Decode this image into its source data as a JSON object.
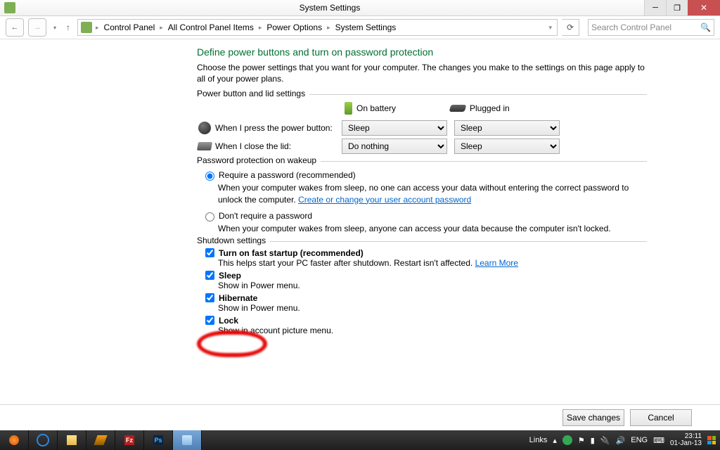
{
  "window": {
    "title": "System Settings"
  },
  "breadcrumb": {
    "items": [
      "Control Panel",
      "All Control Panel Items",
      "Power Options",
      "System Settings"
    ]
  },
  "search": {
    "placeholder": "Search Control Panel"
  },
  "page": {
    "heading": "Define power buttons and turn on password protection",
    "intro": "Choose the power settings that you want for your computer. The changes you make to the settings on this page apply to all of your power plans."
  },
  "group1": {
    "legend": "Power button and lid settings",
    "col_battery": "On battery",
    "col_plugged": "Plugged in",
    "row_power_label": "When I press the power button:",
    "row_power_batt": "Sleep",
    "row_power_plug": "Sleep",
    "row_lid_label": "When I close the lid:",
    "row_lid_batt": "Do nothing",
    "row_lid_plug": "Sleep"
  },
  "group2": {
    "legend": "Password protection on wakeup",
    "opt1_label": "Require a password (recommended)",
    "opt1_desc_a": "When your computer wakes from sleep, no one can access your data without entering the correct password to unlock the computer. ",
    "opt1_link": "Create or change your user account password",
    "opt2_label": "Don't require a password",
    "opt2_desc": "When your computer wakes from sleep, anyone can access your data because the computer isn't locked."
  },
  "group3": {
    "legend": "Shutdown settings",
    "chk1_label": "Turn on fast startup (recommended)",
    "chk1_desc_a": "This helps start your PC faster after shutdown. Restart isn't affected. ",
    "chk1_link": "Learn More",
    "chk2_label": "Sleep",
    "chk2_desc": "Show in Power menu.",
    "chk3_label": "Hibernate",
    "chk3_desc": "Show in Power menu.",
    "chk4_label": "Lock",
    "chk4_desc": "Show in account picture menu."
  },
  "buttons": {
    "save": "Save changes",
    "cancel": "Cancel"
  },
  "tray": {
    "links": "Links",
    "lang": "ENG",
    "time": "23:11",
    "date": "01-Jan-13"
  }
}
